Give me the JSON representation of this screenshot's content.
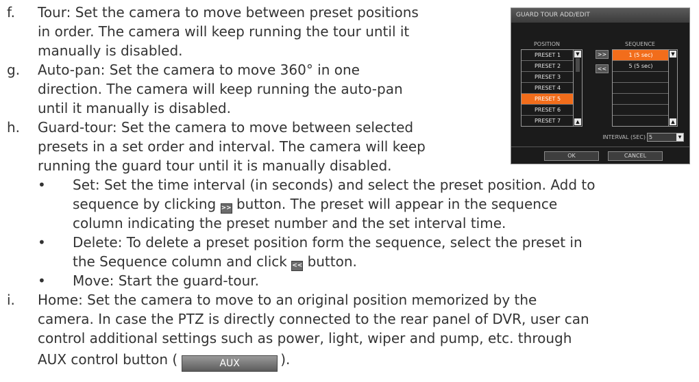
{
  "items": [
    {
      "letter": "f.",
      "lines": [
        "Tour: Set the camera to move between preset positions",
        "in order. The camera will keep running the tour until it",
        "manually is disabled."
      ]
    },
    {
      "letter": "g.",
      "lines": [
        "Auto-pan: Set the camera to move 360° in one",
        "direction. The camera will keep running the auto-pan",
        "until it manually is disabled."
      ]
    },
    {
      "letter": "h.",
      "lines": [
        "Guard-tour: Set the camera to move between selected",
        "presets in a set order and interval. The camera will keep",
        "running the guard tour until it is manually disabled."
      ]
    }
  ],
  "bullets": {
    "set": {
      "line1": "Set: Set the time interval (in seconds) and select the preset position. Add to",
      "line2_before": "sequence by clicking",
      "line2_after": "button. The preset will appear in the sequence",
      "line3": "column indicating the preset number and the set interval time.",
      "icon_label": ">>"
    },
    "delete": {
      "line1": "Delete: To delete a preset position form the sequence, select the preset in",
      "line2_before": "the Sequence column and click",
      "line2_after": "button.",
      "icon_label": "<<"
    },
    "move": {
      "line1": "Move: Start the guard-tour."
    }
  },
  "home": {
    "letter": "i.",
    "line1": "Home: Set the camera to move to an original position memorized by the",
    "line2": "camera. In case the PTZ is directly connected to the rear panel of DVR, user can",
    "line3": "control additional settings such as power, light, wiper and pump, etc. through",
    "line4_before": "AUX control button (",
    "aux_label": "AUX",
    "line4_after": ")."
  },
  "dialog": {
    "title": "GUARD TOUR ADD/EDIT",
    "position_header": "POSITION",
    "sequence_header": "SEQUENCE",
    "positions": [
      "PRESET 1",
      "PRESET 2",
      "PRESET 3",
      "PRESET 4",
      "PRESET 5",
      "PRESET 6",
      "PRESET 7"
    ],
    "selected_position": "PRESET 5",
    "sequence": [
      "1 (5 sec)",
      "5 (5 sec)",
      "",
      "",
      "",
      "",
      ""
    ],
    "selected_sequence": "1 (5 sec)",
    "add_label": ">>",
    "remove_label": "<<",
    "interval_label": "INTERVAL (SEC)",
    "interval_value": "5",
    "ok_label": "OK",
    "cancel_label": "CANCEL",
    "accent_color": "#f26d1b"
  }
}
